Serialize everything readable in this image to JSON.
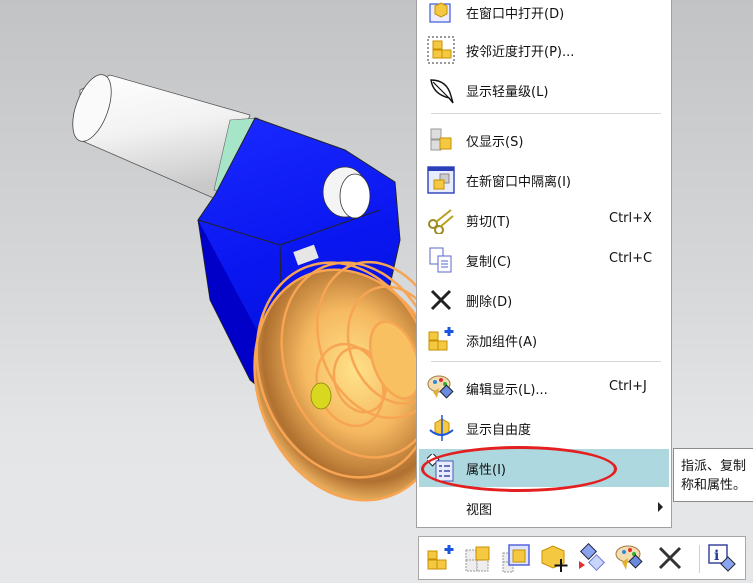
{
  "viewport": {
    "description": "3D CAD assembly model viewport",
    "colors": {
      "background_top": "#c2c3c5",
      "background_bottom": "#e6e7e9",
      "body_blue": "#0010e8",
      "shaft_white": "#f4f4f4",
      "ring_teal": "#a8e6cf",
      "highlight_orange": "#f7a552",
      "pin_yellow": "#e0e020"
    }
  },
  "context_menu": {
    "items": [
      {
        "id": "open-in-window",
        "label": "在窗口中打开(D)",
        "icon": "open-in-window-icon"
      },
      {
        "id": "open-by-proximity",
        "label": "按邻近度打开(P)...",
        "icon": "proximity-open-icon"
      },
      {
        "id": "show-lightweight",
        "label": "显示轻量级(L)",
        "icon": "feather-icon"
      },
      {
        "id": "show-only",
        "label": "仅显示(S)",
        "icon": "show-only-icon"
      },
      {
        "id": "isolate-new-window",
        "label": "在新窗口中隔离(I)",
        "icon": "isolate-window-icon"
      },
      {
        "id": "cut",
        "label": "剪切(T)",
        "shortcut": "Ctrl+X",
        "icon": "scissors-icon"
      },
      {
        "id": "copy",
        "label": "复制(C)",
        "shortcut": "Ctrl+C",
        "icon": "copy-icon"
      },
      {
        "id": "delete",
        "label": "删除(D)",
        "icon": "delete-x-icon"
      },
      {
        "id": "add-component",
        "label": "添加组件(A)",
        "icon": "add-component-icon"
      },
      {
        "id": "edit-display",
        "label": "编辑显示(L)...",
        "shortcut": "Ctrl+J",
        "icon": "palette-icon"
      },
      {
        "id": "show-dof",
        "label": "显示自由度",
        "icon": "degrees-of-freedom-icon"
      },
      {
        "id": "properties",
        "label": "属性(I)",
        "icon": "properties-icon",
        "highlighted": true
      },
      {
        "id": "view",
        "label": "视图",
        "has_submenu": true
      }
    ],
    "highlight_color": "#add8e0"
  },
  "tooltip": {
    "text": "指派、复制\n称和属性。"
  },
  "annotation": {
    "shape": "ellipse",
    "color": "#e41f1f",
    "target": "属性(I)"
  },
  "mini_toolbar": {
    "buttons": [
      {
        "id": "add-component",
        "icon": "add-component-icon"
      },
      {
        "id": "show-only",
        "icon": "show-only-icon"
      },
      {
        "id": "isolate",
        "icon": "isolate-window-icon"
      },
      {
        "id": "move-component",
        "icon": "move-component-icon"
      },
      {
        "id": "replace-reference",
        "icon": "replace-reference-icon"
      },
      {
        "id": "edit-display",
        "icon": "palette-icon"
      },
      {
        "id": "delete",
        "icon": "delete-x-icon"
      },
      {
        "id": "information",
        "icon": "info-icon"
      }
    ]
  }
}
